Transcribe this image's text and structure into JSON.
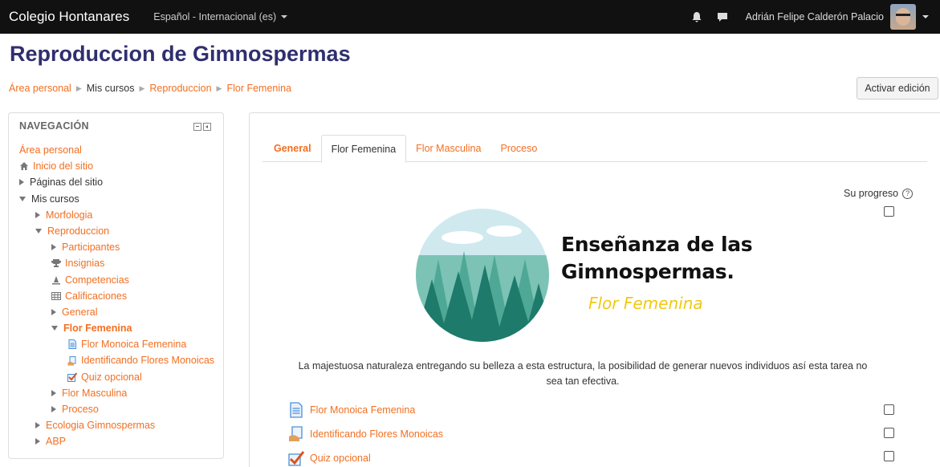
{
  "navbar": {
    "brand": "Colegio Hontanares",
    "language": "Español - Internacional (es)",
    "user_name": "Adrián Felipe Calderón Palacio"
  },
  "page": {
    "title": "Reproduccion de Gimnospermas",
    "edit_button": "Activar edición"
  },
  "breadcrumb": [
    "Área personal",
    "Mis cursos",
    "Reproduccion",
    "Flor Femenina"
  ],
  "navigation": {
    "heading": "NAVEGACIÓN",
    "items": [
      {
        "label": "Área personal"
      },
      {
        "label": "Inicio del sitio"
      },
      {
        "label": "Páginas del sitio"
      },
      {
        "label": "Mis cursos"
      },
      {
        "label": "Morfologia"
      },
      {
        "label": "Reproduccion"
      },
      {
        "label": "Participantes"
      },
      {
        "label": "Insignias"
      },
      {
        "label": "Competencias"
      },
      {
        "label": "Calificaciones"
      },
      {
        "label": "General"
      },
      {
        "label": "Flor Femenina"
      },
      {
        "label": "Flor Monoica Femenina"
      },
      {
        "label": "Identificando Flores Monoicas"
      },
      {
        "label": "Quiz opcional"
      },
      {
        "label": "Flor Masculina"
      },
      {
        "label": "Proceso"
      },
      {
        "label": "Ecologia Gimnospermas"
      },
      {
        "label": "ABP"
      }
    ]
  },
  "tabs": [
    "General",
    "Flor Femenina",
    "Flor Masculina",
    "Proceso"
  ],
  "progress_label": "Su progreso",
  "banner": {
    "title_line1": "Enseñanza de las",
    "title_line2": "Gimnospermas.",
    "subtitle": "Flor Femenina"
  },
  "description": "La majestuosa naturaleza entregando su belleza a esta estructura, la posibilidad de generar nuevos individuos así esta tarea no sea tan efectiva.",
  "activities": [
    {
      "label": "Flor Monoica Femenina",
      "icon": "page-icon"
    },
    {
      "label": "Identificando Flores Monoicas",
      "icon": "assign-icon"
    },
    {
      "label": "Quiz opcional",
      "icon": "quiz-icon"
    }
  ],
  "colors": {
    "link": "#f26f21",
    "navbar": "#111111",
    "title": "#2f2f6f"
  }
}
